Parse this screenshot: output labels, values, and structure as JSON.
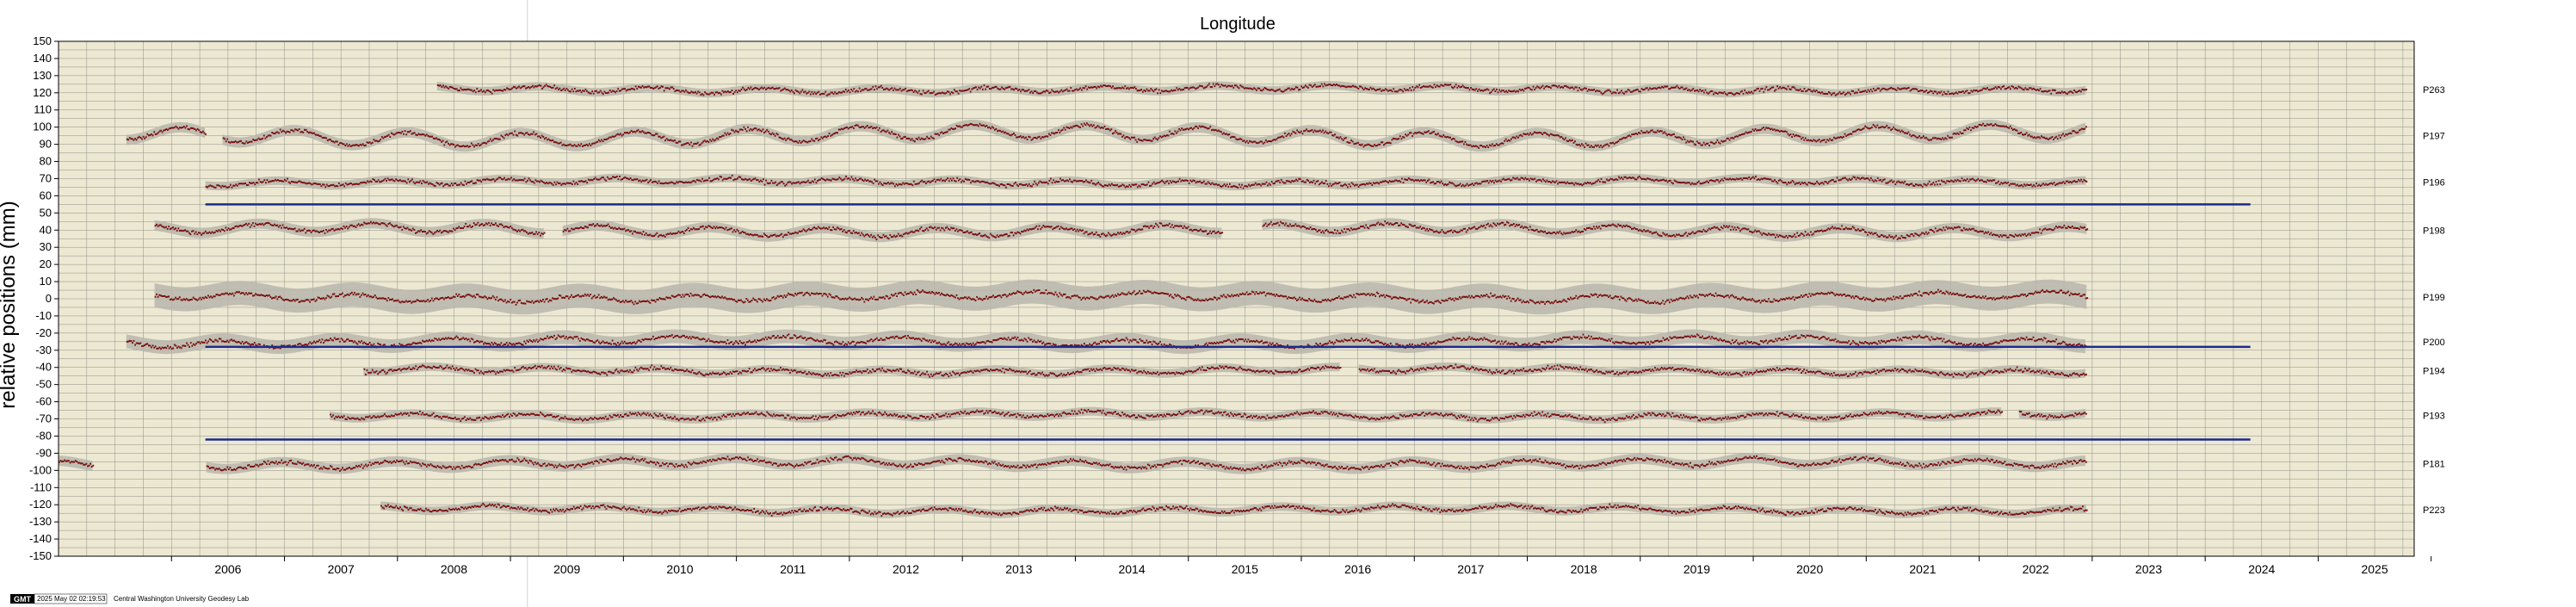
{
  "chart_data": {
    "type": "scatter",
    "title": "Longitude",
    "ylabel": "relative positions (mm)",
    "xlabel": "",
    "xlim": [
      2005.0,
      2025.85
    ],
    "ylim": [
      -150,
      150
    ],
    "ytick_step": 10,
    "x_tick_labels": [
      "2006",
      "2007",
      "2008",
      "2009",
      "2010",
      "2011",
      "2012",
      "2013",
      "2014",
      "2015",
      "2016",
      "2017",
      "2018",
      "2019",
      "2020",
      "2021",
      "2022",
      "2023",
      "2024",
      "2025"
    ],
    "grid": true,
    "series": [
      {
        "name": "P263",
        "offset": 122,
        "start": 2008.35,
        "end": 2022.95,
        "band": 2.5,
        "amplitude": 1.5,
        "gaps": []
      },
      {
        "name": "P197",
        "offset": 95,
        "start": 2005.6,
        "end": 2022.95,
        "band": 3,
        "amplitude": 4,
        "gaps": [
          [
            2006.3,
            2006.45
          ]
        ]
      },
      {
        "name": "P196",
        "offset": 68,
        "start": 2006.3,
        "end": 2022.95,
        "band": 2.5,
        "amplitude": 1.5,
        "gaps": []
      },
      {
        "name": "P198",
        "offset": 40,
        "start": 2005.85,
        "end": 2022.95,
        "band": 3,
        "amplitude": 2.5,
        "gaps": [
          [
            2009.3,
            2009.45
          ],
          [
            2015.3,
            2015.65
          ]
        ]
      },
      {
        "name": "P199",
        "offset": 1,
        "start": 2005.85,
        "end": 2022.95,
        "band": 7,
        "amplitude": 2,
        "gaps": []
      },
      {
        "name": "P200",
        "offset": -25,
        "start": 2005.6,
        "end": 2022.95,
        "band": 4,
        "amplitude": 2,
        "gaps": []
      },
      {
        "name": "P194",
        "offset": -42,
        "start": 2007.7,
        "end": 2022.95,
        "band": 2.5,
        "amplitude": 1.5,
        "gaps": [
          [
            2016.35,
            2016.5
          ]
        ]
      },
      {
        "name": "P193",
        "offset": -68,
        "start": 2007.4,
        "end": 2022.95,
        "band": 2.5,
        "amplitude": 1.5,
        "gaps": [
          [
            2022.2,
            2022.35
          ]
        ]
      },
      {
        "name": "P181",
        "offset": -96,
        "start": 2005.0,
        "end": 2022.95,
        "band": 3,
        "amplitude": 2,
        "gaps": [
          [
            2005.3,
            2006.3
          ]
        ]
      },
      {
        "name": "P223",
        "offset": -123,
        "start": 2007.85,
        "end": 2022.95,
        "band": 2.5,
        "amplitude": 1.5,
        "gaps": []
      }
    ],
    "reference_lines": [
      {
        "y": 55,
        "x_start": 2006.3,
        "x_end": 2024.4
      },
      {
        "y": -28,
        "x_start": 2006.3,
        "x_end": 2024.4
      },
      {
        "y": -82,
        "x_start": 2006.3,
        "x_end": 2024.4
      }
    ],
    "event_marker_year": 2009.15,
    "colors": {
      "background": "#ece8d2",
      "grid": "#8f8f88",
      "points": "#7a1010",
      "band": "#b8b6ad",
      "reference_line": "#1c2a8a",
      "event_line": "#cfcfcf"
    }
  },
  "footer": {
    "logo_text": "GMT",
    "timestamp": "2025 May 02 02:19:53",
    "credit": "Central Washington University Geodesy Lab"
  }
}
